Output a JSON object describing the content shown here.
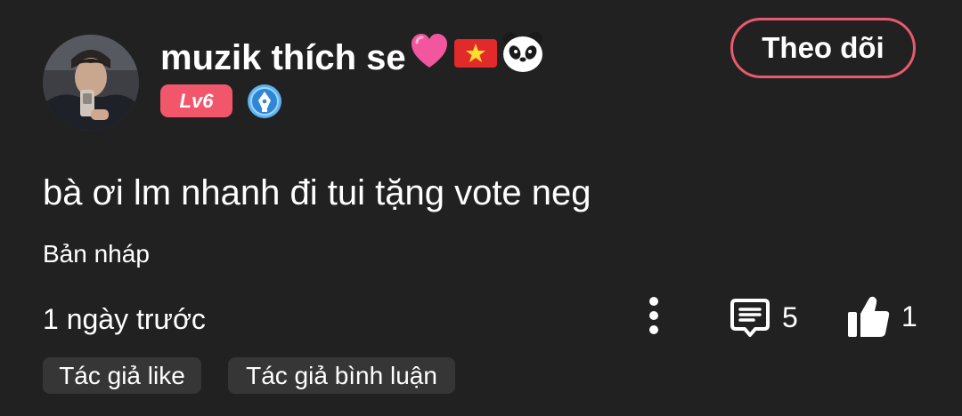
{
  "comment": {
    "username": "muzik thích se",
    "username_emojis": [
      "pink-heart",
      "vietnam-flag",
      "panda-face"
    ],
    "level": "Lv6",
    "follow_label": "Theo dõi",
    "text": "bà ơi lm nhanh đi tui tặng vote neg",
    "draft_label": "Bản nháp",
    "time": "1 ngày trước",
    "reply_count": "5",
    "like_count": "1",
    "tags": [
      "Tác giả like",
      "Tác giả bình luận"
    ]
  },
  "icons": {
    "avatar": "user-photo-avatar",
    "creator_badge": "pen-nib-badge-icon",
    "more": "vertical-dots-icon",
    "reply": "comment-bubble-icon",
    "like": "thumbs-up-icon"
  },
  "colors": {
    "background": "#212121",
    "accent": "#e85a6e",
    "level_badge": "#f2566b",
    "tag_background": "#363636",
    "creator_badge": "#4aa3ea"
  }
}
